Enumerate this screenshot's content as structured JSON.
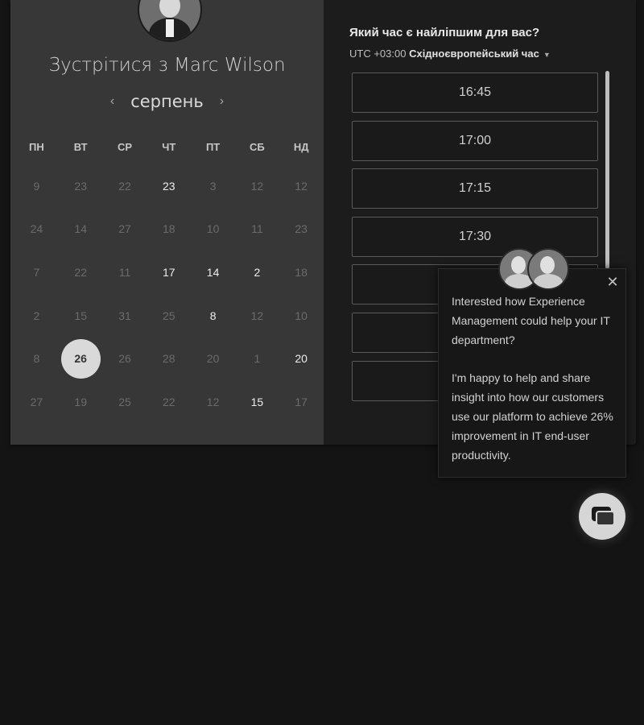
{
  "header": {
    "title": "Зустрітися з Marc Wilson"
  },
  "calendar": {
    "month": "серпень",
    "prev_icon": "‹",
    "next_icon": "›",
    "weekdays": [
      "ПН",
      "ВТ",
      "СР",
      "ЧТ",
      "ПТ",
      "СБ",
      "НД"
    ],
    "weeks": [
      [
        "9",
        "23",
        "22",
        "23",
        "3",
        "12",
        "12"
      ],
      [
        "24",
        "14",
        "27",
        "18",
        "10",
        "11",
        "23"
      ],
      [
        "7",
        "22",
        "11",
        "17",
        "14",
        "2",
        "18"
      ],
      [
        "2",
        "15",
        "31",
        "25",
        "8",
        "12",
        "10"
      ],
      [
        "8",
        "26",
        "26",
        "28",
        "20",
        "1",
        "20"
      ],
      [
        "27",
        "19",
        "25",
        "22",
        "12",
        "15",
        "17"
      ]
    ],
    "active_days": [
      "w0d3",
      "w2d3",
      "w2d4",
      "w2d5",
      "w3d4",
      "w4d1",
      "w4d6",
      "w5d5"
    ],
    "selected_day": "w4d1"
  },
  "timepicker": {
    "question": "Який час є найліпшим для вас?",
    "tz_offset": "UTC +03:00",
    "tz_name": "Східноєвропейський час",
    "slots": [
      "16:45",
      "17:00",
      "17:15",
      "17:30",
      "",
      "",
      ""
    ]
  },
  "popup": {
    "close_icon": "✕",
    "message1": "Interested how Experience Management could help your IT department?",
    "message2": "I'm happy to help and share insight into how our customers use our platform to achieve 26% improvement in IT end-user productivity."
  },
  "icons": {
    "host_avatar": "avatar-icon",
    "agents": [
      "agent-avatar-icon",
      "agent-avatar-icon"
    ],
    "chat": "chat-icon"
  }
}
